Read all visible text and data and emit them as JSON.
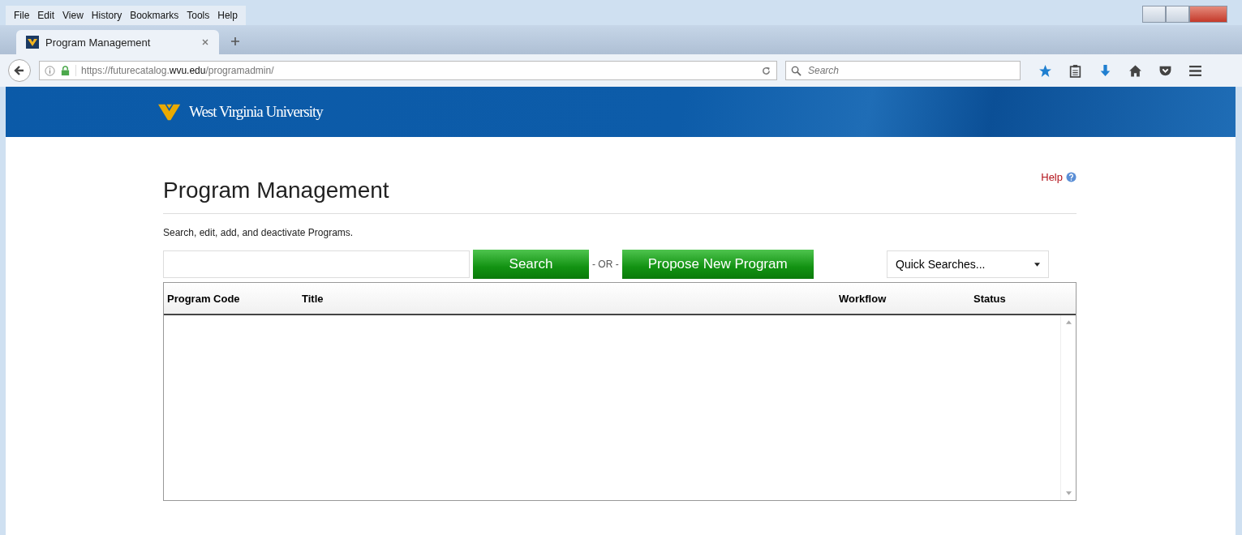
{
  "menu": [
    "File",
    "Edit",
    "View",
    "History",
    "Bookmarks",
    "Tools",
    "Help"
  ],
  "tabs": [
    {
      "label": "Program Management",
      "selected": true
    }
  ],
  "address": {
    "scheme": "https://futurecatalog.",
    "host": "wvu.edu",
    "path": "/programadmin/"
  },
  "browser_search": {
    "placeholder": "Search"
  },
  "banner": {
    "logo_text": "West Virginia University"
  },
  "page": {
    "title": "Program Management",
    "help": "Help",
    "description": "Search, edit, add, and deactivate Programs.",
    "search_button": "Search",
    "or": "- OR -",
    "propose_button": "Propose New Program",
    "quick_searches": "Quick Searches...",
    "columns": [
      "Program Code",
      "Title",
      "Workflow",
      "Status"
    ]
  }
}
